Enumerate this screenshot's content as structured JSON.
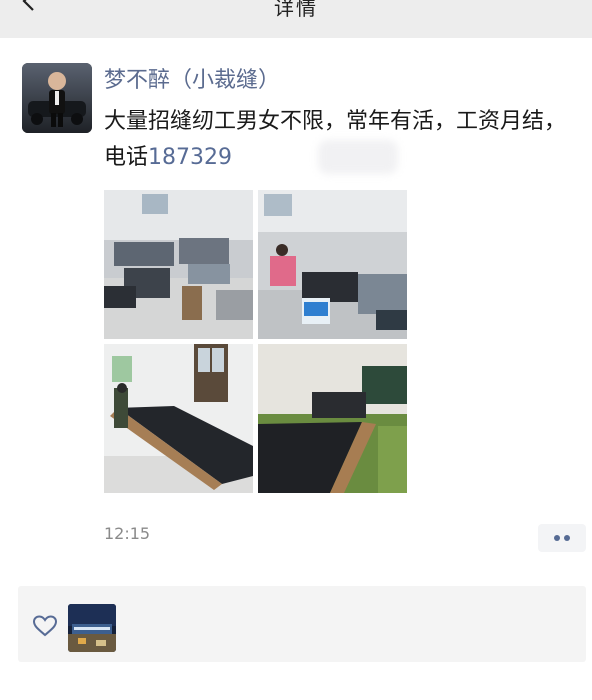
{
  "header": {
    "title": "详情",
    "back_icon": "chevron-left-icon"
  },
  "post": {
    "author": "梦不醉（小裁缝）",
    "text_main": "大量招缝纫工男女不限，常年有活，工资月结，电话",
    "phone_visible": "187329",
    "timestamp": "12:15",
    "photos": [
      "photo-1",
      "photo-2",
      "photo-3",
      "photo-4"
    ]
  },
  "actions": {
    "more_icon": "more-dots-icon"
  },
  "likes": {
    "icon": "heart-outline-icon",
    "liker_avatar": "liker-avatar"
  },
  "colors": {
    "link_blue": "#576b95",
    "name_blue": "#5b6b8f",
    "header_bg": "#ededed",
    "likes_bg": "#f4f4f4"
  }
}
